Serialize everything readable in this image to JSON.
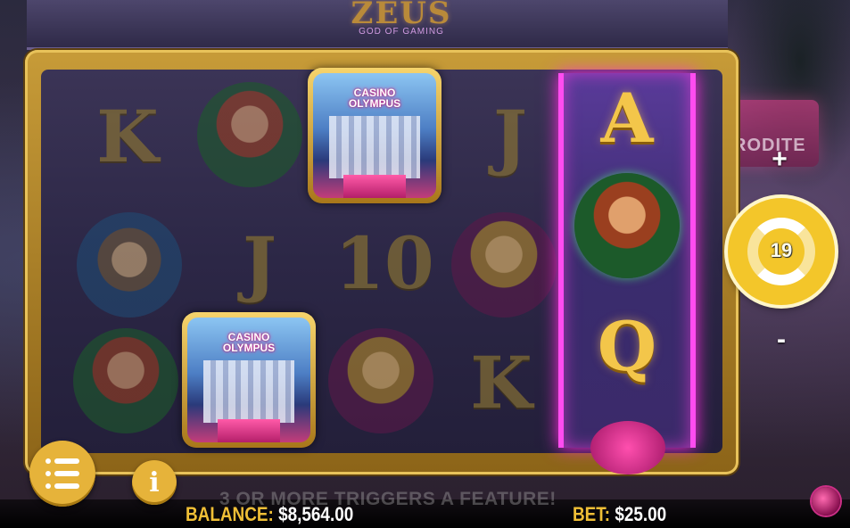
{
  "game": {
    "logo_title": "ZEUS",
    "logo_subtitle": "GOD OF GAMING"
  },
  "side_sign_text": "RODITE",
  "reels": {
    "scatter_line1": "CASINO",
    "scatter_line2": "OLYMPUS",
    "symbols": {
      "r1c1": "K",
      "r1c5": "J",
      "r2c2": "J",
      "r2c3": "10",
      "r3c5": "K",
      "hot_top": "A",
      "hot_bottom": "Q"
    }
  },
  "controls": {
    "plus": "+",
    "minus": "-",
    "spins_left": "19",
    "info": "i"
  },
  "footer": {
    "feature_hint": "3 OR MORE     TRIGGERS A FEATURE!",
    "balance_label": "BALANCE:",
    "balance_value": "$8,564.00",
    "bet_label": "BET:",
    "bet_value": "$25.00"
  },
  "colors": {
    "gold": "#f0bf36",
    "hot_reel": "#ff4cf0",
    "spin_button": "#f3c62a"
  }
}
